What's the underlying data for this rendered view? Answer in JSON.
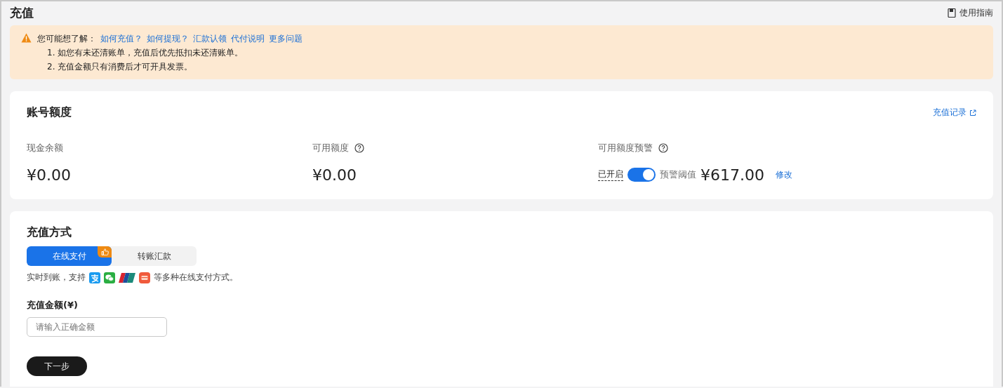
{
  "page": {
    "title": "充值",
    "guide_link": "使用指南"
  },
  "notice": {
    "lead": "您可能想了解：",
    "links": [
      "如何充值？",
      "如何提现？",
      "汇款认领",
      "代付说明",
      "更多问题"
    ],
    "lines": [
      "1. 如您有未还清账单，充值后优先抵扣未还清账单。",
      "2. 充值金额只有消费后才可开具发票。"
    ]
  },
  "account": {
    "title": "账号额度",
    "record_link": "充值记录",
    "metrics": [
      {
        "kind": "plain",
        "label": "现金余额",
        "value": "¥0.00"
      },
      {
        "kind": "help",
        "label": "可用额度",
        "value": "¥0.00"
      },
      {
        "kind": "alert",
        "label": "可用额度预警",
        "status": "已开启",
        "on": true,
        "threshold_label": "预警阈值",
        "value": "¥617.00",
        "edit": "修改"
      }
    ]
  },
  "payment": {
    "title": "充值方式",
    "tabs": [
      {
        "label": "在线支付",
        "selected": true,
        "recommended": true
      },
      {
        "label": "转账汇款",
        "selected": false,
        "recommended": false
      }
    ],
    "note_before": "实时到账，支持",
    "note_after": "等多种在线支付方式。",
    "amount_label": "充值金额(¥)",
    "amount_placeholder": "请输入正确金额",
    "next_button": "下一步"
  }
}
